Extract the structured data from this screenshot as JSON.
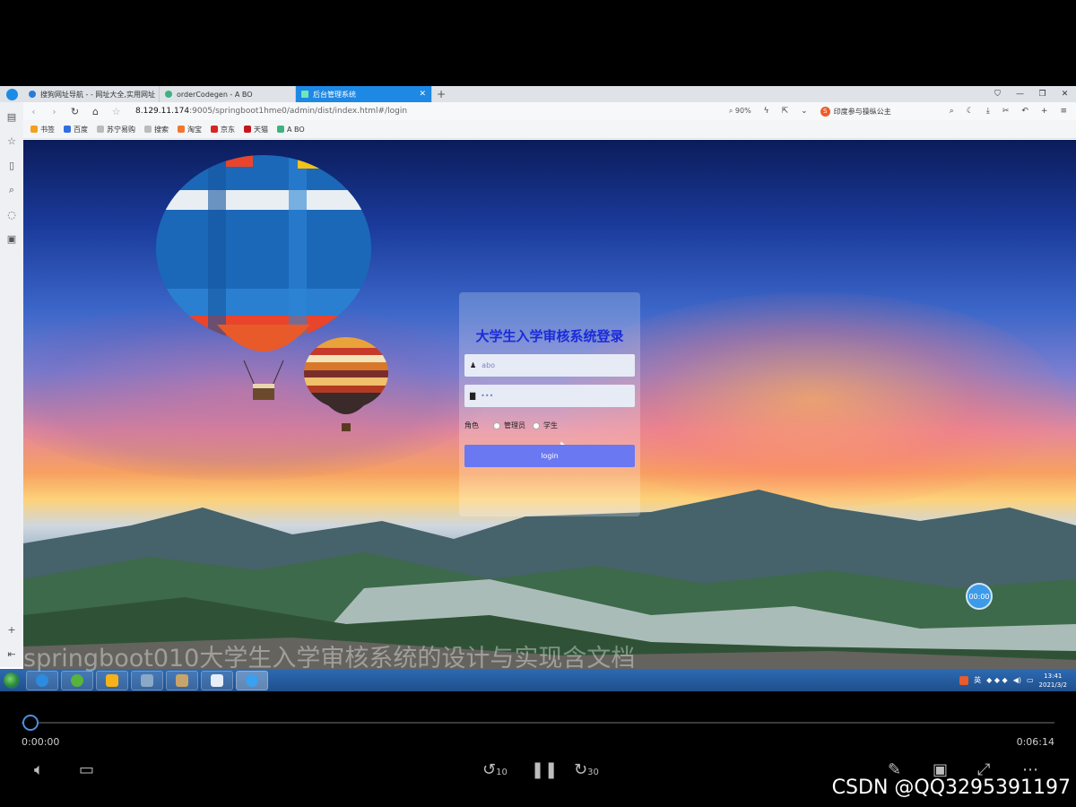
{
  "browser": {
    "tabs": [
      {
        "label": "搜狗网址导航 - - 网址大全,实用网址"
      },
      {
        "label": "orderCodegen - A BO"
      },
      {
        "label": "后台管理系统"
      }
    ],
    "url_host": "8.129.11.174",
    "url_rest": ":9005/springboot1hme0/admin/dist/index.html#/login",
    "zoom": "90%",
    "search_text": "印度参与操纵公主",
    "bookmarks": [
      "书签",
      "百度",
      "苏宁易购",
      "搜索",
      "淘宝",
      "京东",
      "天猫",
      "A BO"
    ]
  },
  "login": {
    "title": "大学生入学审核系统登录",
    "username_value": "abo",
    "password_value": "•••",
    "role_label": "角色",
    "role_options": [
      "管理员",
      "学生"
    ],
    "button_label": "login"
  },
  "page": {
    "timer_badge": "00:00"
  },
  "taskbar": {
    "ime": "英",
    "clock_time": "13:41",
    "clock_date": "2021/3/2"
  },
  "overlay": {
    "watermark": "springboot010大学生入学审核系统的设计与实现含文档",
    "credit": "CSDN @QQ3295391197"
  },
  "player": {
    "time_current": "0:00:00",
    "time_total": "0:06:14",
    "progress": 0,
    "rewind_seconds": "10",
    "forward_seconds": "30"
  },
  "colors": {
    "accent_tab": "#1e88e5",
    "login_title": "#1c2bd8",
    "login_button": "#6a78f2"
  }
}
